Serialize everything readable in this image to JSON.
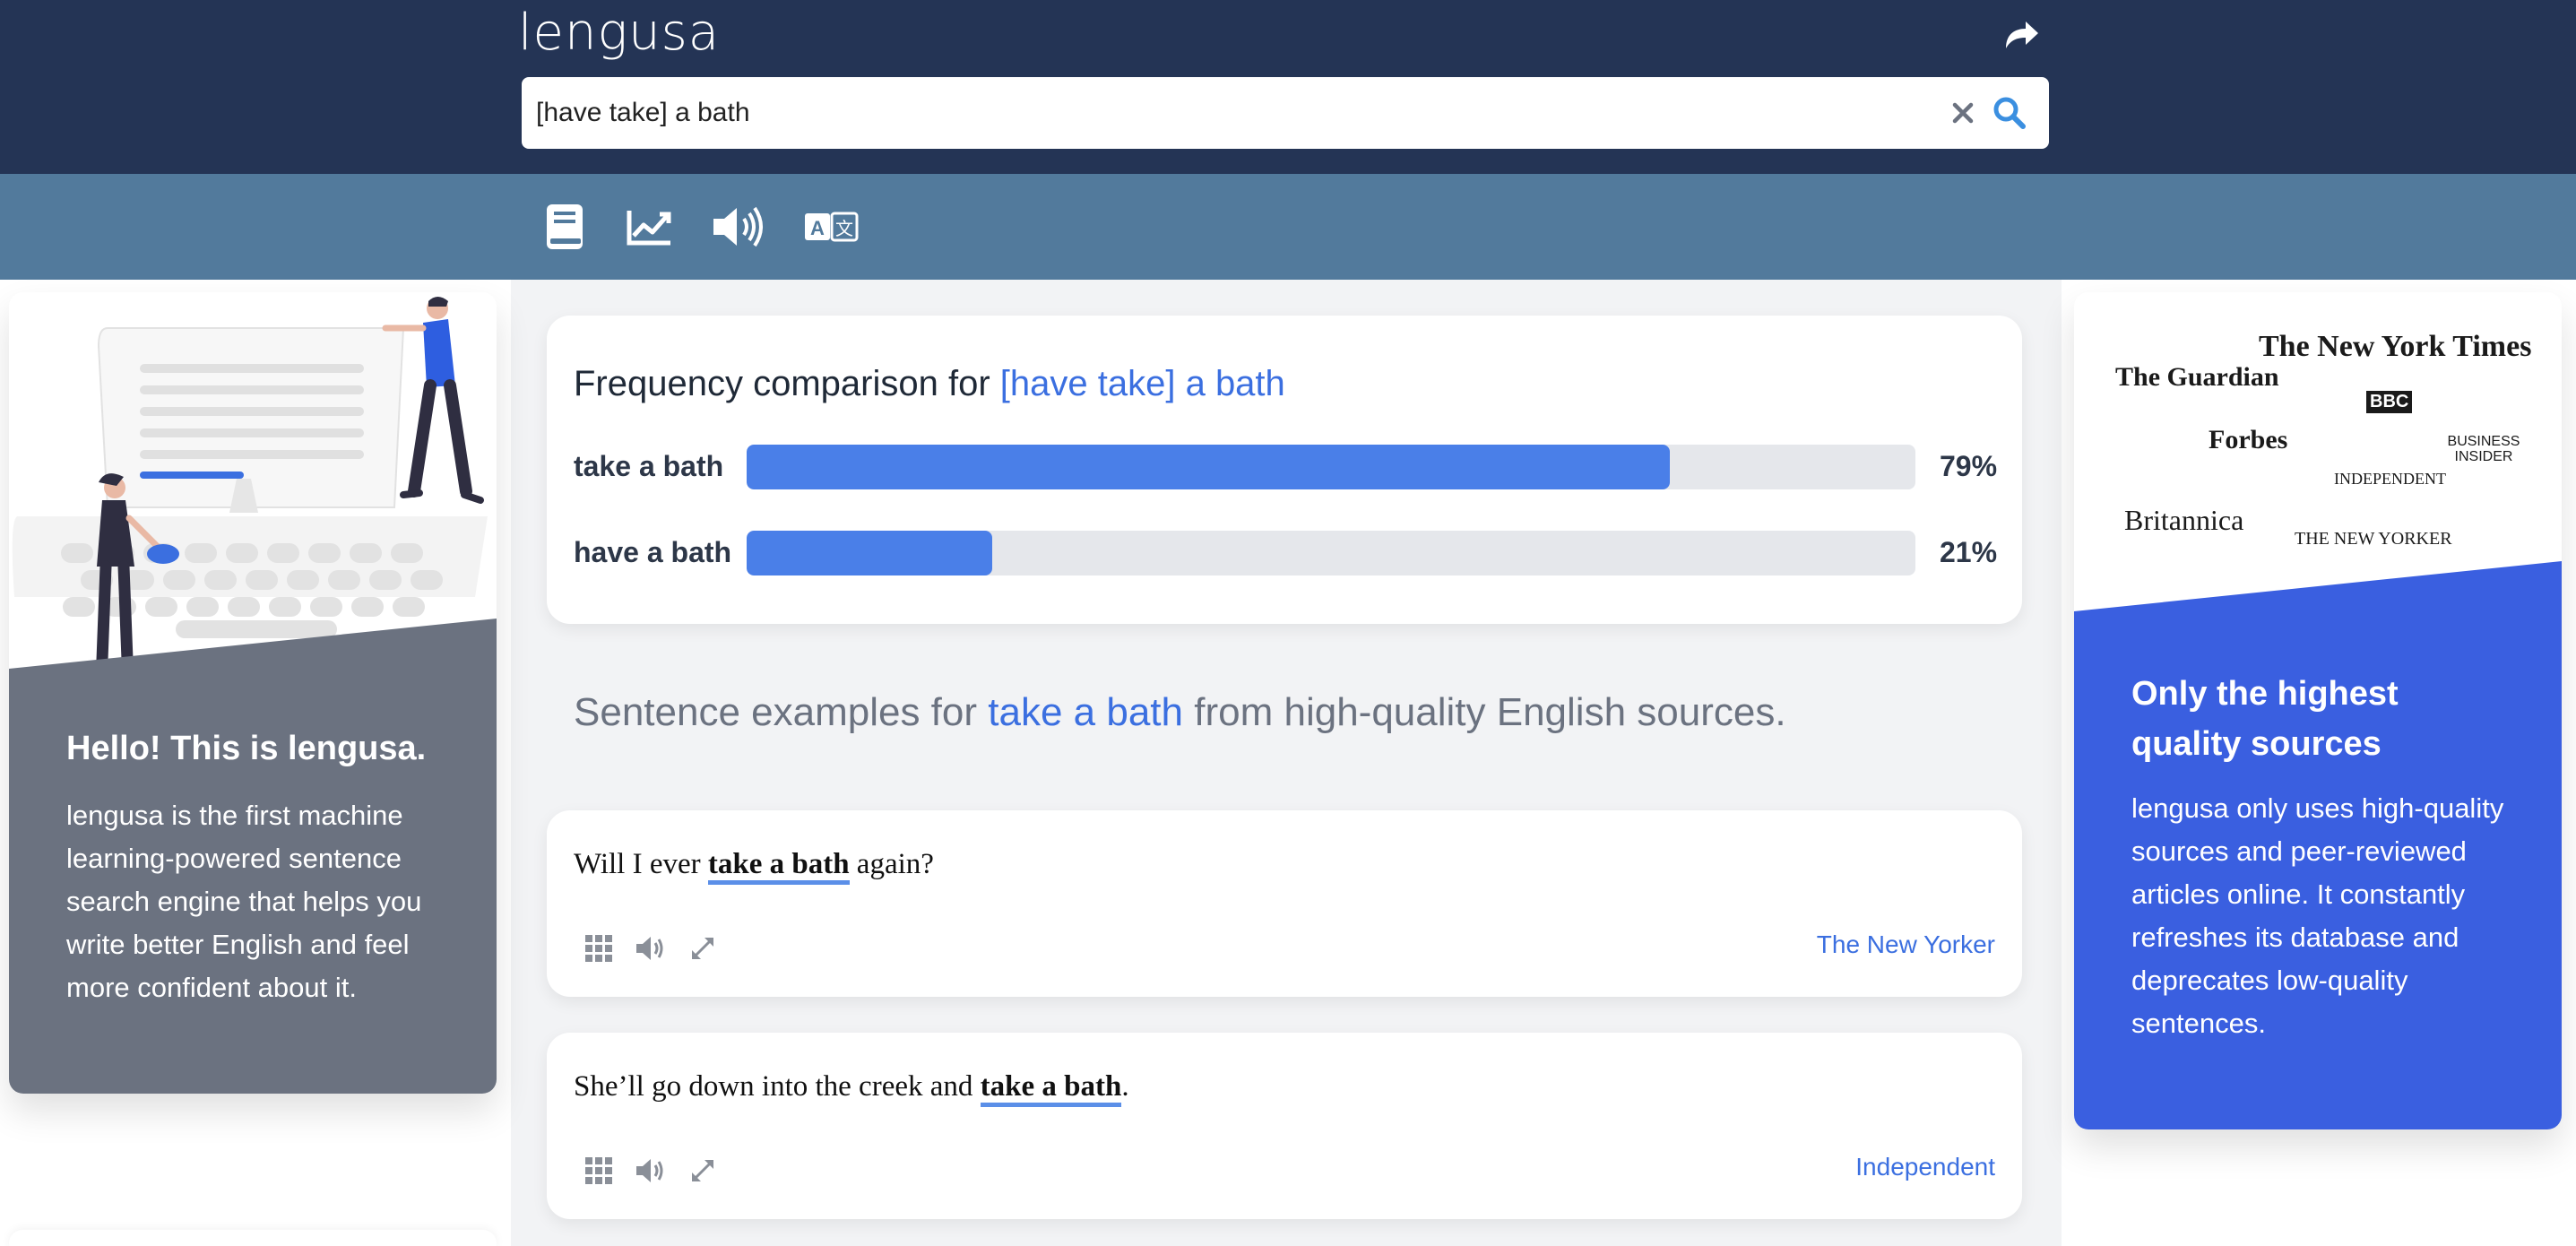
{
  "header": {
    "logo": "lengusa",
    "share_icon": "share-icon",
    "search": {
      "value": "[have take] a bath",
      "placeholder": ""
    }
  },
  "toolbar": {
    "tools": [
      {
        "name": "dictionary",
        "icon": "book-icon"
      },
      {
        "name": "trends",
        "icon": "trend-chart-icon"
      },
      {
        "name": "pronunciation",
        "icon": "speaker-icon"
      },
      {
        "name": "translate",
        "icon": "translate-icon"
      }
    ]
  },
  "frequency": {
    "title_prefix": "Frequency comparison for",
    "query": "[have take] a bath",
    "rows": [
      {
        "label": "take a bath",
        "percent": 79,
        "percent_text": "79%"
      },
      {
        "label": "have a bath",
        "percent": 21,
        "percent_text": "21%"
      }
    ]
  },
  "examples": {
    "heading_prefix": "Sentence examples for",
    "phrase": "take a bath",
    "heading_suffix": "from high-quality English sources.",
    "items": [
      {
        "before": "Will I ever ",
        "highlight": "take a bath",
        "after": " again?",
        "source": "The New Yorker"
      },
      {
        "before": "She’ll go down into the creek and ",
        "highlight": "take a bath",
        "after": ".",
        "source": "Independent"
      }
    ]
  },
  "left_panel": {
    "title": "Hello! This is lengusa.",
    "text": "lengusa is the first machine learning-powered sentence search engine that helps you write better English and feel more confident about it."
  },
  "right_panel": {
    "logos": [
      "The New York Times",
      "The Guardian",
      "BBC",
      "Forbes",
      "BUSINESS INSIDER",
      "INDEPENDENT",
      "Britannica",
      "THE NEW YORKER"
    ],
    "title": "Only the highest quality sources",
    "text": "lengusa only uses high-quality sources and peer-reviewed articles online. It constantly refreshes its database and deprecates low-quality sentences."
  },
  "colors": {
    "header": "#243455",
    "toolbar": "#527a9c",
    "accent": "#3b6fe0",
    "bar": "#4a7fe8",
    "left_panel": "#6b7280",
    "right_panel": "#3a5fe0"
  }
}
